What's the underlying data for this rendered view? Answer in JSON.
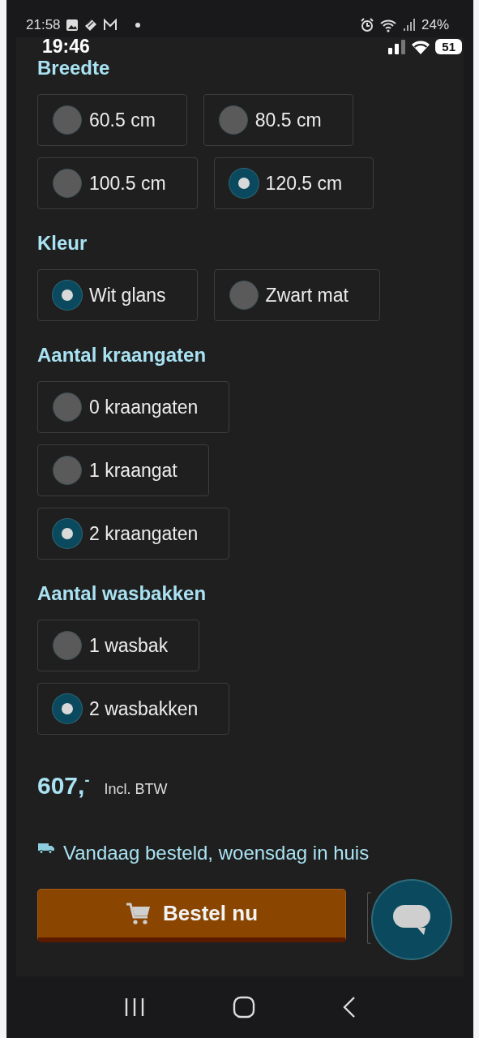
{
  "status_bar": {
    "back_time": "21:58",
    "back_battery": "24%",
    "time": "19:46",
    "battery": "51"
  },
  "option_groups": [
    {
      "title": "Breedte",
      "rows": [
        [
          {
            "label": "60.5 cm",
            "selected": false
          },
          {
            "label": "80.5 cm",
            "selected": false
          }
        ],
        [
          {
            "label": "100.5 cm",
            "selected": false
          },
          {
            "label": "120.5 cm",
            "selected": true
          }
        ]
      ]
    },
    {
      "title": "Kleur",
      "rows": [
        [
          {
            "label": "Wit glans",
            "selected": true
          },
          {
            "label": "Zwart mat",
            "selected": false
          }
        ]
      ]
    },
    {
      "title": "Aantal kraangaten",
      "rows": [
        [
          {
            "label": "0 kraangaten",
            "selected": false
          }
        ],
        [
          {
            "label": "1 kraangat",
            "selected": false
          }
        ],
        [
          {
            "label": "2 kraangaten",
            "selected": true
          }
        ]
      ]
    },
    {
      "title": "Aantal wasbakken",
      "rows": [
        [
          {
            "label": "1 wasbak",
            "selected": false
          }
        ],
        [
          {
            "label": "2 wasbakken",
            "selected": true
          }
        ]
      ]
    }
  ],
  "price": {
    "amount": "607,$^{-}$",
    "note": "Incl. BTW"
  },
  "delivery": "Vandaag besteld, woensdag in huis",
  "order_button": "Bestel nu"
}
